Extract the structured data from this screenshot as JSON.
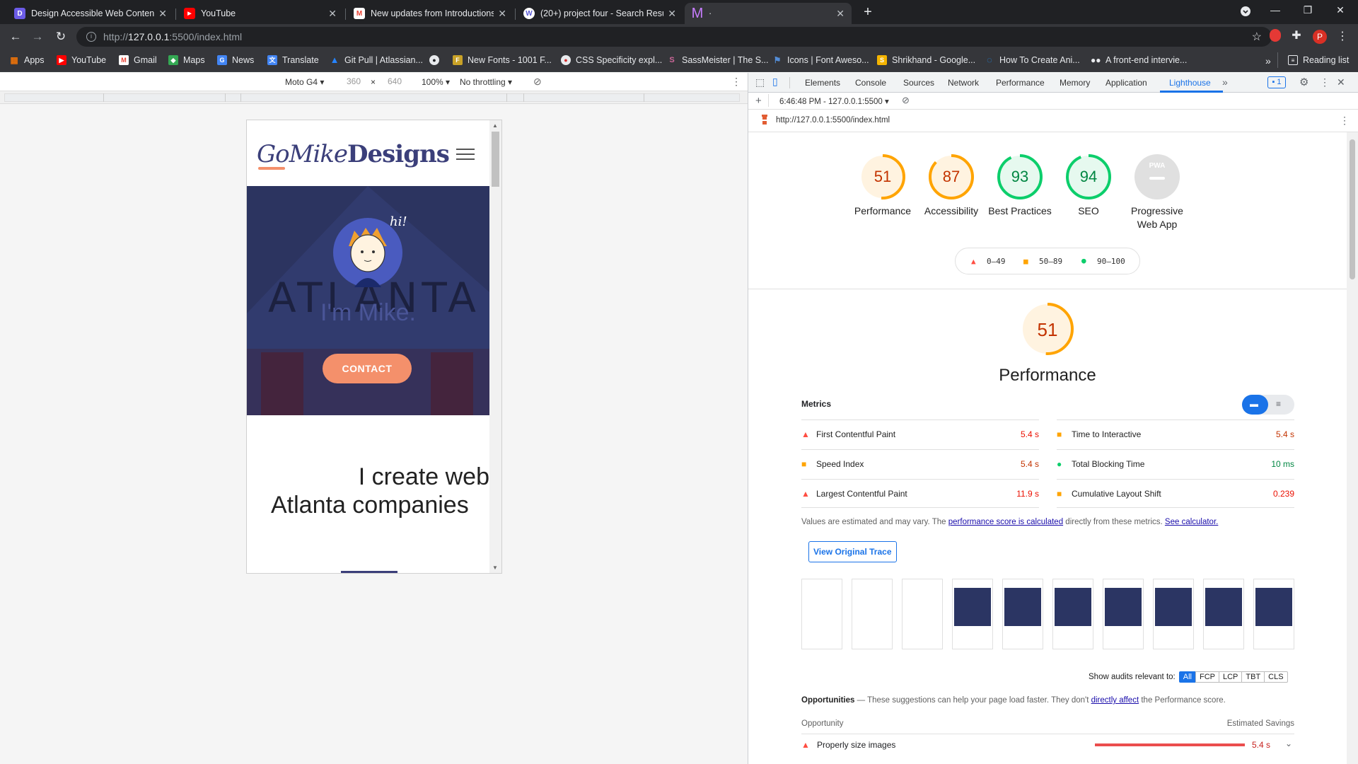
{
  "tabs": [
    {
      "title": "Design Accessible Web Content",
      "icon": "D",
      "color": "#6c5ce7"
    },
    {
      "title": "YouTube",
      "icon": "▶",
      "color": "#ff0000"
    },
    {
      "title": "New updates from Introductions",
      "icon": "M",
      "color": "#ea4335"
    },
    {
      "title": "(20+) project four - Search Result",
      "icon": "W",
      "color": "#5b5bd6"
    },
    {
      "title": "·",
      "icon": "M",
      "color": "#c77dff"
    }
  ],
  "address": {
    "scheme": "http://",
    "host": "127.0.0.1",
    "rest": ":5500/index.html"
  },
  "profile_initial": "P",
  "bookmarks": [
    {
      "label": "Apps",
      "color": "#e8710a"
    },
    {
      "label": "YouTube",
      "color": "#ff0000"
    },
    {
      "label": "Gmail",
      "color": "#ea4335"
    },
    {
      "label": "Maps",
      "color": "#34a853"
    },
    {
      "label": "News",
      "color": "#4285f4"
    },
    {
      "label": "Translate",
      "color": "#4285f4"
    },
    {
      "label": "Git Pull | Atlassian...",
      "color": "#2684ff"
    },
    {
      "label": "",
      "color": "#e8eaed"
    },
    {
      "label": "New Fonts - 1001 F...",
      "color": "#c9a227"
    },
    {
      "label": "CSS Specificity expl...",
      "color": "#e8eaed"
    },
    {
      "label": "SassMeister | The S...",
      "color": "#cd6799"
    },
    {
      "label": "Icons | Font Aweso...",
      "color": "#538dd7"
    },
    {
      "label": "Shrikhand - Google...",
      "color": "#f4b400"
    },
    {
      "label": "How To Create Ani...",
      "color": "#1e88e5"
    },
    {
      "label": "A front-end intervie...",
      "color": "#e8eaed"
    }
  ],
  "reading_list": "Reading list",
  "device": {
    "name": "Moto G4",
    "width": "360",
    "height": "640",
    "zoom": "100%",
    "throttle": "No throttling"
  },
  "site": {
    "logo_a": "GoMike",
    "logo_b": "Designs",
    "greeting": "hi!",
    "bg_word": "ATLANTA",
    "intro": "I'm Mike.",
    "contact": "CONTACT",
    "headline_1": "I create web",
    "headline_2": "Atlanta companies"
  },
  "devtools": {
    "tabs": [
      "Elements",
      "Console",
      "Sources",
      "Network",
      "Performance",
      "Memory",
      "Application",
      "Lighthouse"
    ],
    "issues_count": "1",
    "report_time": "6:46:48 PM - 127.0.0.1:5500",
    "report_url": "http://127.0.0.1:5500/index.html"
  },
  "scores": [
    {
      "value": 51,
      "label": "Performance",
      "color": "#ffa400"
    },
    {
      "value": 87,
      "label": "Accessibility",
      "color": "#ffa400"
    },
    {
      "value": 93,
      "label": "Best Practices",
      "color": "#0cce6b"
    },
    {
      "value": 94,
      "label": "SEO",
      "color": "#0cce6b"
    },
    {
      "value": null,
      "label": "Progressive Web App",
      "badge": "PWA",
      "color": "#9e9e9e"
    }
  ],
  "legend": {
    "fail": "0–49",
    "average": "50–89",
    "pass": "90–100"
  },
  "perf": {
    "score": 51,
    "title": "Performance"
  },
  "metrics_title": "Metrics",
  "metrics": [
    {
      "name": "First Contentful Paint",
      "value": "5.4 s",
      "status": "fail"
    },
    {
      "name": "Time to Interactive",
      "value": "5.4 s",
      "status": "average"
    },
    {
      "name": "Speed Index",
      "value": "5.4 s",
      "status": "average"
    },
    {
      "name": "Total Blocking Time",
      "value": "10 ms",
      "status": "pass"
    },
    {
      "name": "Largest Contentful Paint",
      "value": "11.9 s",
      "status": "fail"
    },
    {
      "name": "Cumulative Layout Shift",
      "value": "0.239",
      "status": "average"
    }
  ],
  "note": {
    "pre": "Values are estimated and may vary. The ",
    "link1": "performance score is calculated",
    "mid": " directly from these metrics. ",
    "link2": "See calculator."
  },
  "trace_button": "View Original Trace",
  "audit_filter": {
    "label": "Show audits relevant to:",
    "chips": [
      "All",
      "FCP",
      "LCP",
      "TBT",
      "CLS"
    ]
  },
  "opportunities": {
    "title": "Opportunities",
    "desc_pre": " — These suggestions can help your page load faster. They don't ",
    "desc_link": "directly affect",
    "desc_post": " the Performance score.",
    "col1": "Opportunity",
    "col2": "Estimated Savings",
    "items": [
      {
        "name": "Properly size images",
        "savings": "5.4 s",
        "bar": 0.95
      }
    ]
  }
}
